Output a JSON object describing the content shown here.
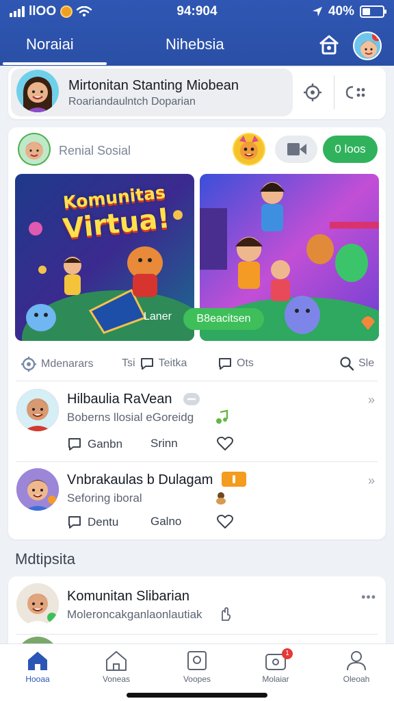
{
  "status_bar": {
    "carrier": "llOO",
    "time": "94:904",
    "battery": "40%"
  },
  "header": {
    "tabs": [
      {
        "label": "Noraiai"
      },
      {
        "label": "Nihebsia"
      }
    ],
    "notification_badge": "!"
  },
  "profile": {
    "name": "Mirtonitan Stanting Miobean",
    "subtitle": "Roariandaulntch Doparian"
  },
  "feed": {
    "title": "Renial Sosial",
    "green_button": "0 loos",
    "banner_left": {
      "title_line1": "Komunitas",
      "title_line2": "Virtua!",
      "button": "Laner"
    },
    "banner_right": {
      "button": "B8eacitsen"
    },
    "actions": [
      {
        "label": "Mdenarars",
        "icon": "globe-icon"
      },
      {
        "label": "Tsi",
        "label2": "Teitka",
        "icon": "chat-bubble-icon"
      },
      {
        "label": "Ots",
        "icon": "chat-bubble-icon"
      },
      {
        "label": "Sle",
        "icon": "search-icon"
      }
    ],
    "posts": [
      {
        "title": "Hilbaulia RaVean",
        "subtitle": "Boberns llosial eGoreidg",
        "comment": "Ganbn",
        "share": "Srinn"
      },
      {
        "title": "Vnbrakaulas b Dulagam",
        "subtitle": "Seforing iboral",
        "comment": "Dentu",
        "share": "Galno"
      }
    ]
  },
  "section": {
    "title": "Mdtipsita"
  },
  "list_item": {
    "title": "Komunitan Slibarian",
    "subtitle": "Moleroncakganlaonlautiak"
  },
  "bottom_nav": [
    {
      "label": "Hooaa"
    },
    {
      "label": "Voneas"
    },
    {
      "label": "Voopes"
    },
    {
      "label": "Molaiar",
      "badge": "1"
    },
    {
      "label": "Oleoah"
    }
  ],
  "colors": {
    "primary": "#2f57b3",
    "green": "#30b25c",
    "badge": "#e53935"
  }
}
